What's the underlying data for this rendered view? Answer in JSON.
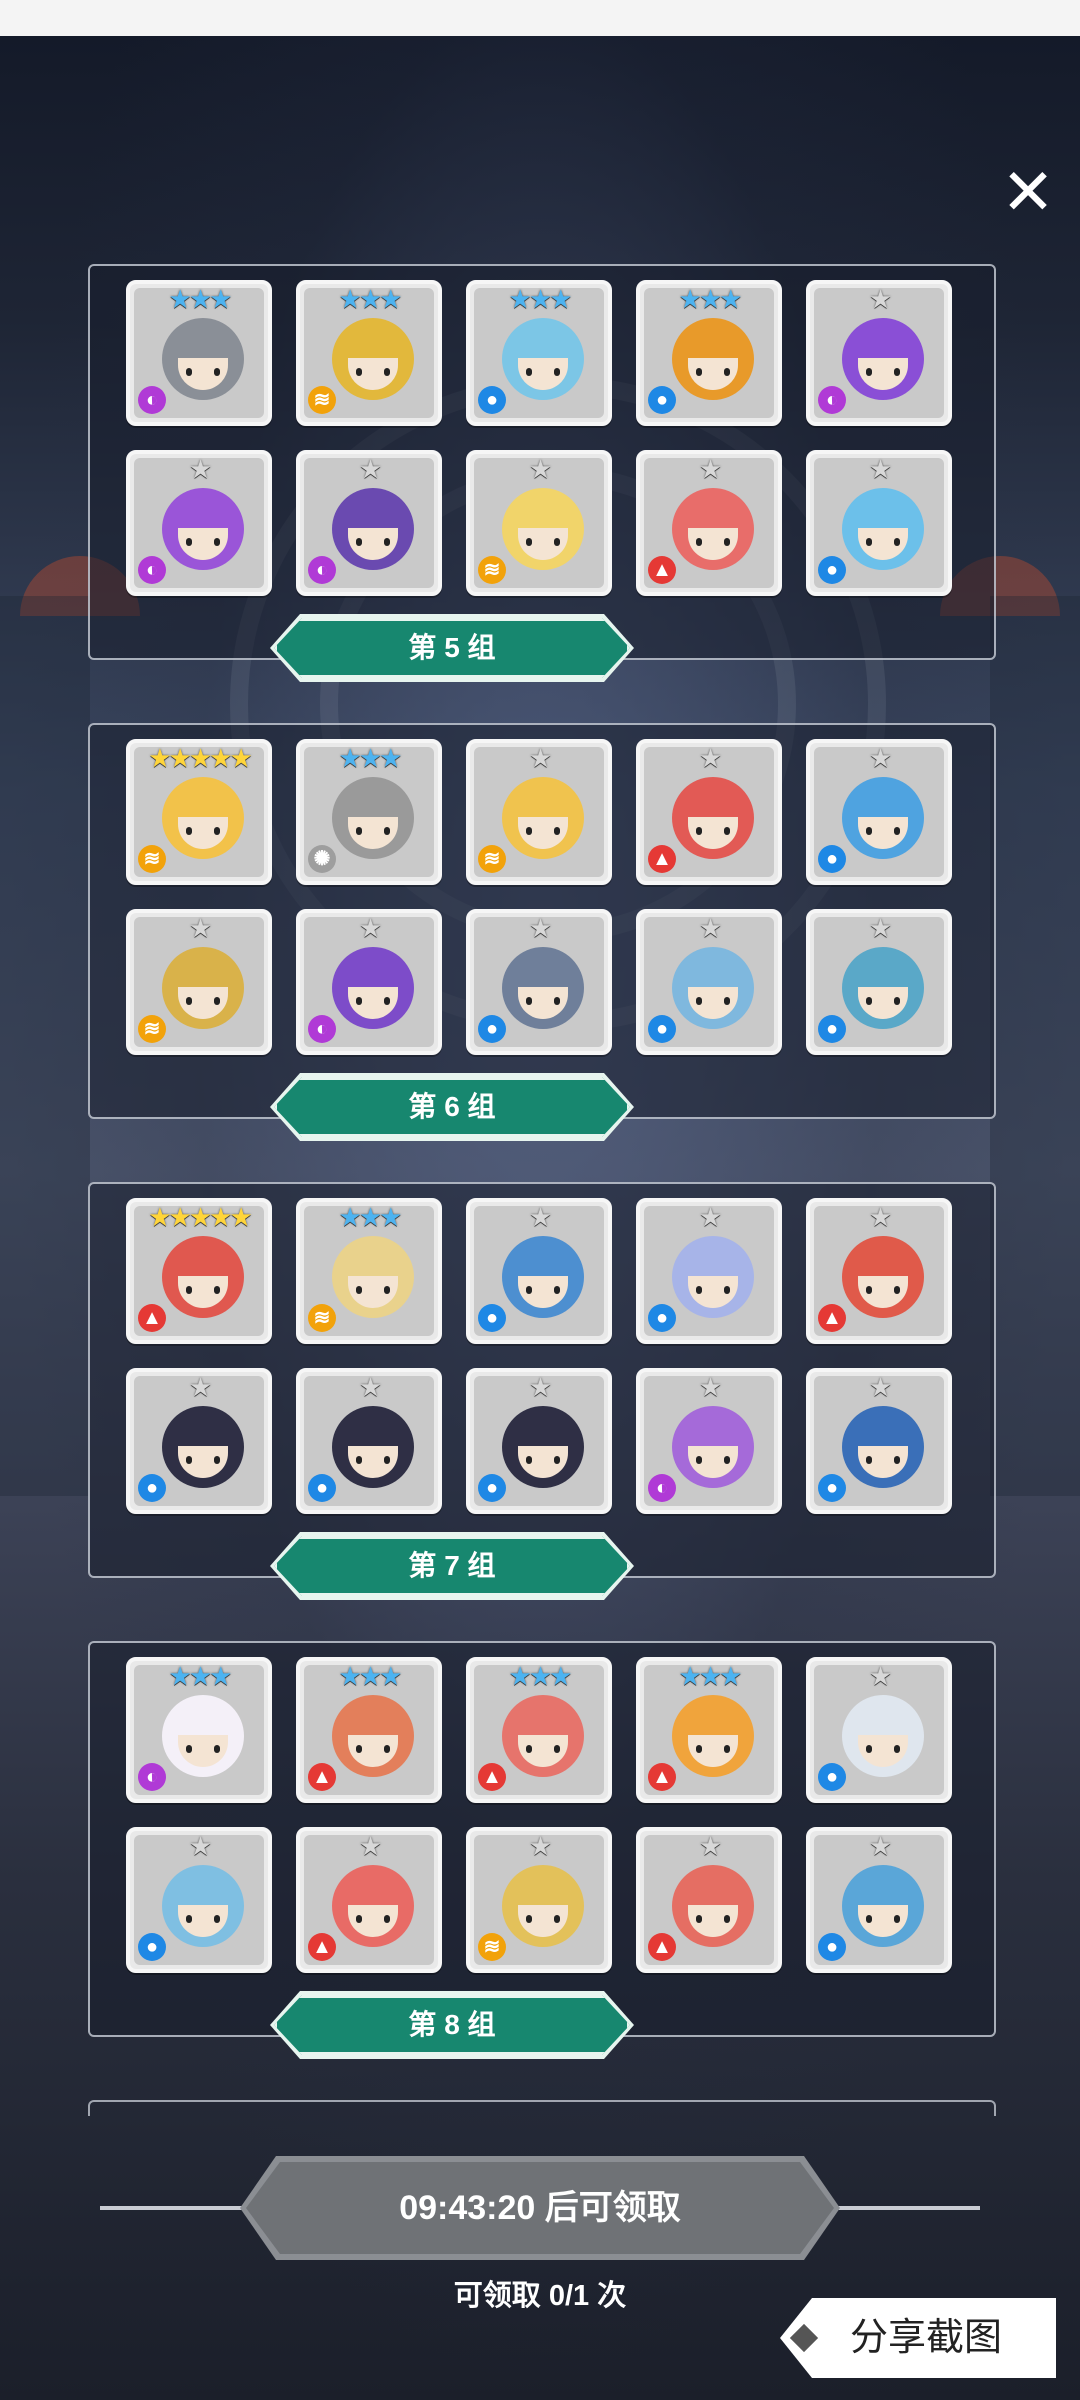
{
  "groups": [
    {
      "title": "第 5 组",
      "heroes": [
        {
          "stars": "★★★",
          "tier": "blue",
          "element": "el-dark",
          "color": "#8a8f97"
        },
        {
          "stars": "★★★",
          "tier": "blue",
          "element": "el-wind",
          "color": "#e2b83c"
        },
        {
          "stars": "★★★",
          "tier": "blue",
          "element": "el-water",
          "color": "#7cc6e6"
        },
        {
          "stars": "★★★",
          "tier": "blue",
          "element": "el-water",
          "color": "#e89a2a"
        },
        {
          "stars": "★",
          "tier": "silver",
          "element": "el-dark",
          "color": "#8a4fd6"
        },
        {
          "stars": "★",
          "tier": "silver",
          "element": "el-dark",
          "color": "#9a55d8"
        },
        {
          "stars": "★",
          "tier": "silver",
          "element": "el-dark",
          "color": "#6a4ab0"
        },
        {
          "stars": "★",
          "tier": "silver",
          "element": "el-wind",
          "color": "#f1d46a"
        },
        {
          "stars": "★",
          "tier": "silver",
          "element": "el-fire",
          "color": "#e86d6a"
        },
        {
          "stars": "★",
          "tier": "silver",
          "element": "el-water",
          "color": "#6cc0ea"
        }
      ]
    },
    {
      "title": "第 6 组",
      "heroes": [
        {
          "stars": "★★★★★",
          "tier": "gold",
          "element": "el-wind",
          "color": "#f2c24a"
        },
        {
          "stars": "★★★",
          "tier": "blue",
          "element": "el-light",
          "color": "#9a9a9a"
        },
        {
          "stars": "★",
          "tier": "silver",
          "element": "el-wind",
          "color": "#f0c34e"
        },
        {
          "stars": "★",
          "tier": "silver",
          "element": "el-fire",
          "color": "#e25a55"
        },
        {
          "stars": "★",
          "tier": "silver",
          "element": "el-water",
          "color": "#4fa3e0"
        },
        {
          "stars": "★",
          "tier": "silver",
          "element": "el-wind",
          "color": "#d9b24a"
        },
        {
          "stars": "★",
          "tier": "silver",
          "element": "el-dark",
          "color": "#7d4cc9"
        },
        {
          "stars": "★",
          "tier": "silver",
          "element": "el-water",
          "color": "#6f7f9a"
        },
        {
          "stars": "★",
          "tier": "silver",
          "element": "el-water",
          "color": "#7fb8de"
        },
        {
          "stars": "★",
          "tier": "silver",
          "element": "el-water",
          "color": "#5aa8c8"
        }
      ]
    },
    {
      "title": "第 7 组",
      "heroes": [
        {
          "stars": "★★★★★",
          "tier": "gold",
          "element": "el-fire",
          "color": "#e0584f"
        },
        {
          "stars": "★★★",
          "tier": "blue",
          "element": "el-wind",
          "color": "#e9d28c"
        },
        {
          "stars": "★",
          "tier": "silver",
          "element": "el-water",
          "color": "#4d8fd0"
        },
        {
          "stars": "★",
          "tier": "silver",
          "element": "el-water",
          "color": "#a7b4e8"
        },
        {
          "stars": "★",
          "tier": "silver",
          "element": "el-fire",
          "color": "#e05a4a"
        },
        {
          "stars": "★",
          "tier": "silver",
          "element": "el-water",
          "color": "#2f2f45"
        },
        {
          "stars": "★",
          "tier": "silver",
          "element": "el-water",
          "color": "#2f2f45"
        },
        {
          "stars": "★",
          "tier": "silver",
          "element": "el-water",
          "color": "#2f2f45"
        },
        {
          "stars": "★",
          "tier": "silver",
          "element": "el-dark",
          "color": "#a56ad9"
        },
        {
          "stars": "★",
          "tier": "silver",
          "element": "el-water",
          "color": "#3a6fb8"
        }
      ]
    },
    {
      "title": "第 8 组",
      "heroes": [
        {
          "stars": "★★★",
          "tier": "blue",
          "element": "el-dark",
          "color": "#f4f0f8"
        },
        {
          "stars": "★★★",
          "tier": "blue",
          "element": "el-fire",
          "color": "#e37f5b"
        },
        {
          "stars": "★★★",
          "tier": "blue",
          "element": "el-fire",
          "color": "#e6746c"
        },
        {
          "stars": "★★★",
          "tier": "blue",
          "element": "el-fire",
          "color": "#f0a43c"
        },
        {
          "stars": "★",
          "tier": "silver",
          "element": "el-water",
          "color": "#dfe6ee"
        },
        {
          "stars": "★",
          "tier": "silver",
          "element": "el-water",
          "color": "#7fbfe2"
        },
        {
          "stars": "★",
          "tier": "silver",
          "element": "el-fire",
          "color": "#e86b66"
        },
        {
          "stars": "★",
          "tier": "silver",
          "element": "el-wind",
          "color": "#e3c15a"
        },
        {
          "stars": "★",
          "tier": "silver",
          "element": "el-fire",
          "color": "#e56e63"
        },
        {
          "stars": "★",
          "tier": "silver",
          "element": "el-water",
          "color": "#5aa6d8"
        }
      ]
    }
  ],
  "element_symbols": {
    "el-water": "●",
    "el-fire": "▲",
    "el-wind": "≋",
    "el-dark": "◐",
    "el-light": "✺"
  },
  "close_label": "✕",
  "timer_text": "09:43:20 后可领取",
  "claim_text": "可领取 0/1 次",
  "share_label": "分享截图"
}
